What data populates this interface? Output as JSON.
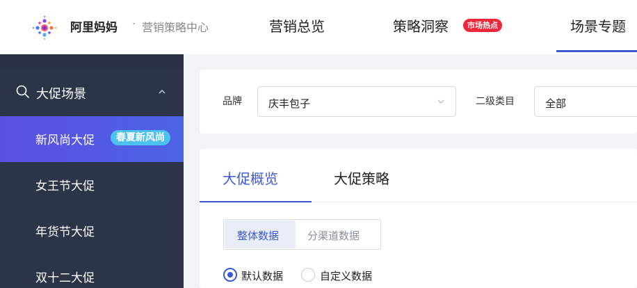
{
  "header": {
    "brand": "阿里妈妈",
    "separator": "·",
    "subtitle": "营销策略中心",
    "nav": [
      {
        "label": "营销总览"
      },
      {
        "label": "策略洞察",
        "badge": "市场热点"
      },
      {
        "label": "场景专题",
        "active": true
      }
    ]
  },
  "sidebar": {
    "group_label": "大促场景",
    "items": [
      {
        "label": "新风尚大促",
        "badge": "春夏新风尚",
        "active": true
      },
      {
        "label": "女王节大促"
      },
      {
        "label": "年货节大促"
      },
      {
        "label": "双十二大促"
      }
    ]
  },
  "filters": {
    "brand_label": "品牌",
    "brand_value": "庆丰包子",
    "category_label": "二级类目",
    "category_value": "全部"
  },
  "content": {
    "tabs": [
      {
        "label": "大促概览",
        "active": true
      },
      {
        "label": "大促策略"
      }
    ],
    "segments": [
      {
        "label": "整体数据",
        "active": true
      },
      {
        "label": "分渠道数据"
      }
    ],
    "radios": [
      {
        "label": "默认数据",
        "checked": true
      },
      {
        "label": "自定义数据"
      }
    ]
  },
  "colors": {
    "accent": "#3b59d6",
    "sidebar_bg": "#2c3447",
    "hot_badge": "#f0263a",
    "new_badge": "#4cc1f0"
  }
}
